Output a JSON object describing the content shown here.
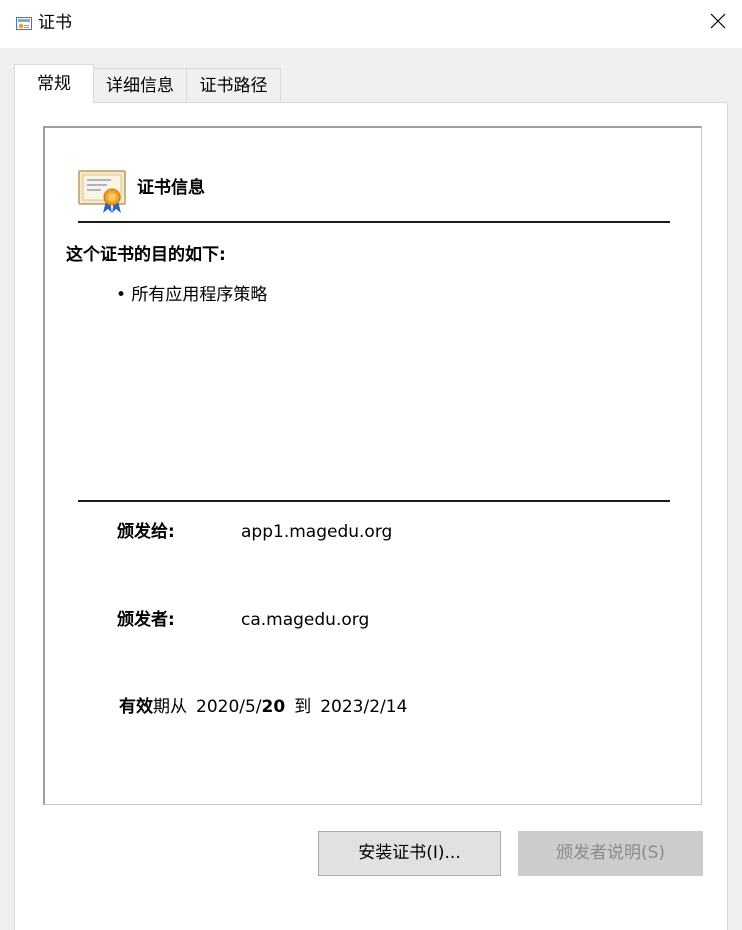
{
  "window": {
    "title": "证书"
  },
  "tabs": [
    {
      "label": "常规",
      "selected": true
    },
    {
      "label": "详细信息",
      "selected": false
    },
    {
      "label": "证书路径",
      "selected": false
    }
  ],
  "cert_info": {
    "header": "证书信息",
    "purpose_heading": "这个证书的目的如下:",
    "purposes": [
      "• 所有应用程序策略"
    ]
  },
  "fields": {
    "issued_to_label": "颁发给:",
    "issued_to_value": "app1.magedu.org",
    "issued_by_label": "颁发者:",
    "issued_by_value": "ca.magedu.org",
    "validity_prefix_bold": "有效",
    "validity_prefix_regular": "期从",
    "valid_from_part1": "2020/5/",
    "valid_from_part2": "20",
    "validity_to": "到",
    "valid_to": "2023/2/14"
  },
  "buttons": {
    "install": "安装证书(I)...",
    "issuer_statement": "颁发者说明(S)",
    "issuer_statement_enabled": false
  },
  "icons": {
    "title": "certificate-icon",
    "close": "close-icon",
    "header": "certificate-icon"
  },
  "colors": {
    "dialog_background": "#f0f0f0",
    "panel_background": "#ffffff",
    "disabled_button": "#cccccc",
    "disabled_text": "#8a8a8a",
    "certificate_ribbon": "#f0a020"
  }
}
